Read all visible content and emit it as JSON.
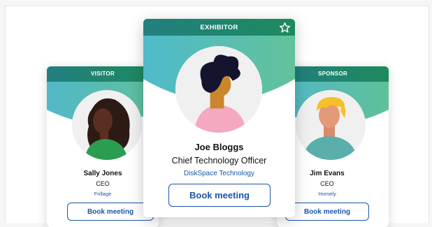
{
  "colors": {
    "accent": "#1a56a8",
    "teal": "#1f8a7e",
    "green": "#46b585",
    "aqua": "#4fb9c9"
  },
  "cards": {
    "visitor": {
      "badge": "VISITOR",
      "name": "Sally Jones",
      "role": "CEO",
      "company": "Frillage",
      "button": "Book meeting"
    },
    "exhibitor": {
      "badge": "EXHIBITOR",
      "name": "Joe Bloggs",
      "role": "Chief Technology Officer",
      "company": "DiskSpace Technology",
      "button": "Book meeting",
      "icon": "star-icon"
    },
    "sponsor": {
      "badge": "SPONSOR",
      "name": "Jim Evans",
      "role": "CEO",
      "company": "Homely",
      "button": "Book meeting"
    }
  }
}
